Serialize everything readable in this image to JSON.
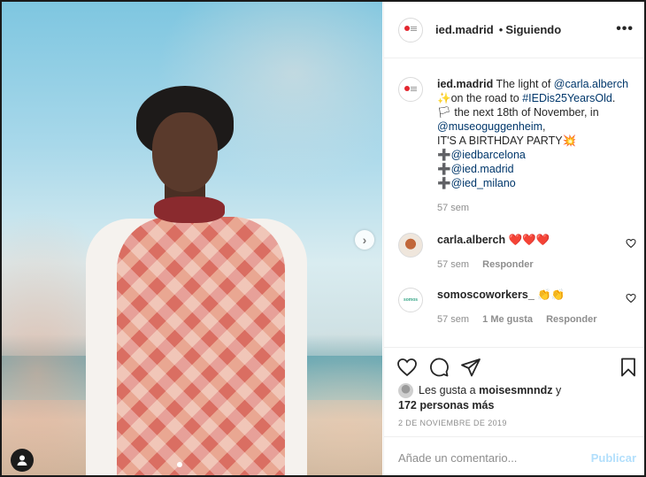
{
  "post": {
    "account": "ied.madrid",
    "separator": "•",
    "follow_status": "Siguiendo",
    "more_icon": "more-dots-icon"
  },
  "caption": {
    "user": "ied.madrid",
    "line1_pre": "The light of ",
    "mention_carla": "@carla.alberch",
    "line2_emoji": "✨",
    "line2_text": "on the road to ",
    "hashtag": "#IEDis25YearsOld",
    "line2_end": ".",
    "line3_emoji": "🏳",
    "line3_text": " the next 18th of November, in",
    "mention_museum": "@museoguggenheim",
    "line4_end": ",",
    "line5": "IT'S A BIRTHDAY PARTY",
    "line5_emoji": "💥",
    "plus": "➕",
    "mention_bcn": "@iedbarcelona",
    "mention_mad": "@ied.madrid",
    "mention_mil": "@ied_milano",
    "time": "57 sem"
  },
  "comments": [
    {
      "user": "carla.alberch",
      "text": "❤️❤️❤️",
      "time": "57 sem",
      "reply": "Responder"
    },
    {
      "user": "somoscoworkers_",
      "avatar_text": "somos",
      "text": "👏👏",
      "time": "57 sem",
      "likes": "1 Me gusta",
      "reply": "Responder"
    }
  ],
  "likes": {
    "prefix": "Les gusta a ",
    "user": "moisesmnndz",
    "joiner": " y",
    "others": "172 personas más"
  },
  "date": "2 DE NOVIEMBRE DE 2019",
  "add_comment": {
    "placeholder": "Añade un comentario...",
    "publish": "Publicar"
  },
  "colors": {
    "link": "#00376b",
    "publish_disabled": "#b2dffc",
    "brand_red": "#e3262f"
  }
}
